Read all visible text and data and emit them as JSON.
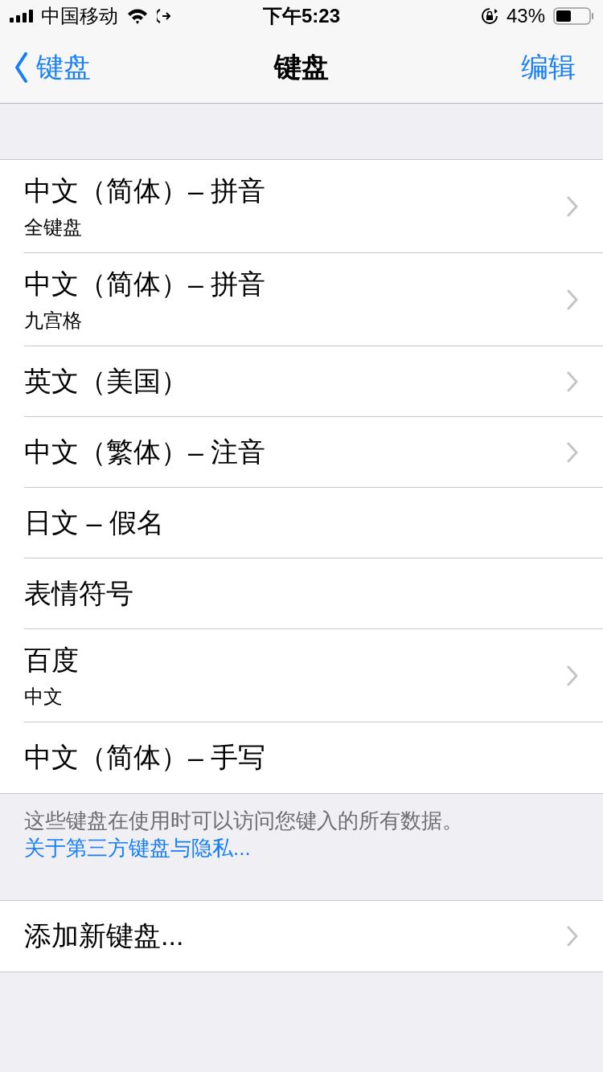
{
  "status_bar": {
    "carrier": "中国移动",
    "time": "下午5:23",
    "battery": "43%"
  },
  "nav_bar": {
    "back": "键盘",
    "title": "键盘",
    "action": "编辑"
  },
  "keyboards": [
    {
      "title": "中文（简体）– 拼音",
      "subtitle": "全键盘",
      "chevron": true
    },
    {
      "title": "中文（简体）– 拼音",
      "subtitle": "九宫格",
      "chevron": true
    },
    {
      "title": "英文（美国）",
      "chevron": true
    },
    {
      "title": "中文（繁体）– 注音",
      "chevron": true
    },
    {
      "title": "日文 – 假名",
      "chevron": false
    },
    {
      "title": "表情符号",
      "chevron": false
    },
    {
      "title": "百度",
      "subtitle": "中文",
      "chevron": true
    },
    {
      "title": "中文（简体）– 手写",
      "chevron": false
    }
  ],
  "footer": {
    "text": "这些键盘在使用时可以访问您键入的所有数据。",
    "link": "关于第三方键盘与隐私..."
  },
  "add_row": {
    "title": "添加新键盘...",
    "chevron": true
  }
}
